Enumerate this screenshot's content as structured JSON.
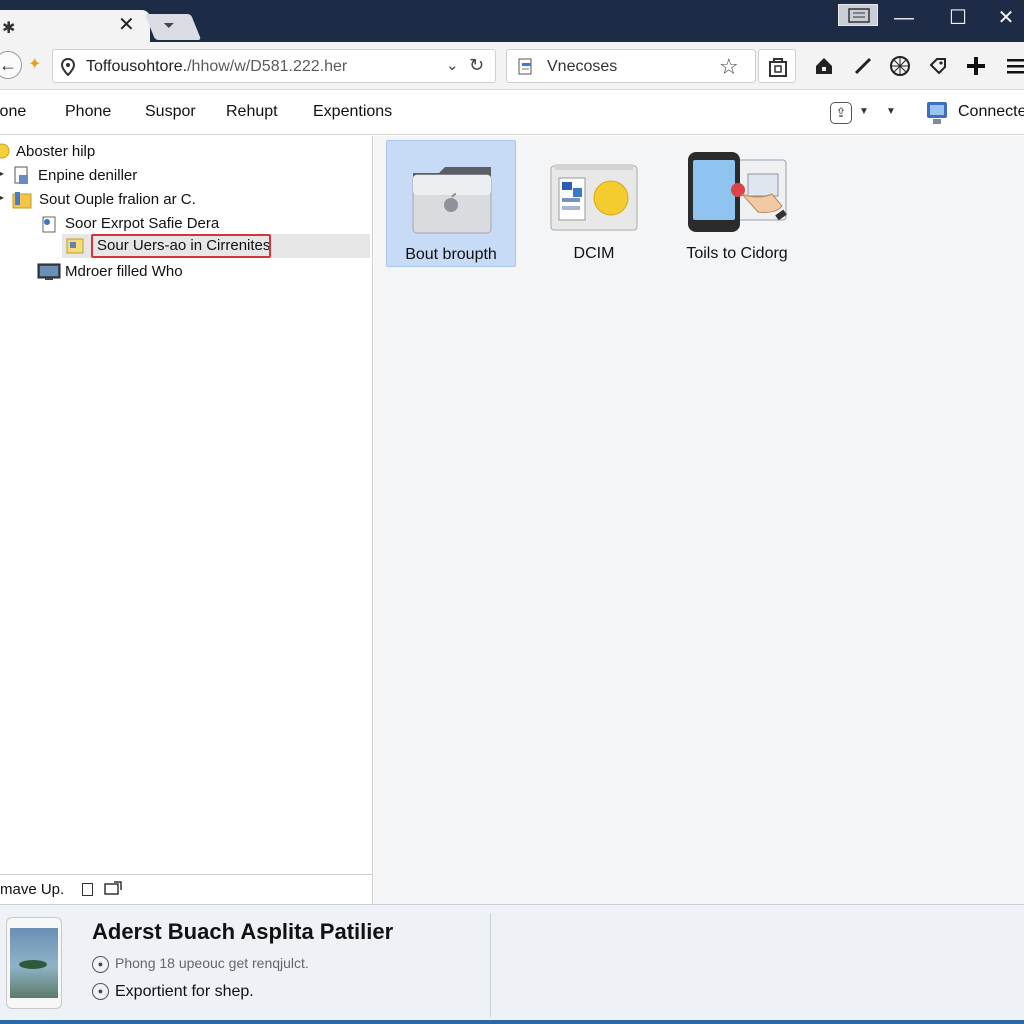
{
  "window": {
    "tab_favicon": "✱",
    "tab_close": "✕",
    "newtab": "⏷",
    "minimize": "—",
    "maximize": "☐",
    "close": "✕"
  },
  "toolbar": {
    "back": "←",
    "url_main": "Toffousohtore.",
    "url_path": "/hhow/w/D581.222.her",
    "url_dropdown": "⌄",
    "reload": "↻",
    "search_text": "Vnecoses",
    "search_star": "☆",
    "icons": [
      "home-icon",
      "pencil-icon",
      "globe-icon",
      "tag-icon",
      "plus-icon",
      "menu-icon"
    ]
  },
  "menu": {
    "items": [
      "ione",
      "Phone",
      "Suspor",
      "Rehupt",
      "Expentions"
    ],
    "connected_label": "Connecte"
  },
  "tree": {
    "items": [
      {
        "label": "Aboster hilp"
      },
      {
        "label": "Enpine deniller"
      },
      {
        "label": "Sout Ouple fralion ar C."
      },
      {
        "label": "Soor Exrpot Safie Dera"
      },
      {
        "label": "Sour Uers-ao in Cirrenites"
      },
      {
        "label": "Mdroer filled Who"
      }
    ],
    "footer_label": "mave Up."
  },
  "content": {
    "items": [
      {
        "label": "Bout broupth",
        "selected": true
      },
      {
        "label": "DCIM",
        "selected": false
      },
      {
        "label": "Toils to Cidorg",
        "selected": false
      }
    ]
  },
  "details": {
    "device_name": "Aderst Buach Asplita Patilier",
    "line1": "Phong 18 upeouc get renqjulct.",
    "line2": "Exportient for shep."
  },
  "colors": {
    "titlebar": "#1d2b46",
    "selection": "#c7dbf6",
    "highlight_border": "#d8333a"
  }
}
